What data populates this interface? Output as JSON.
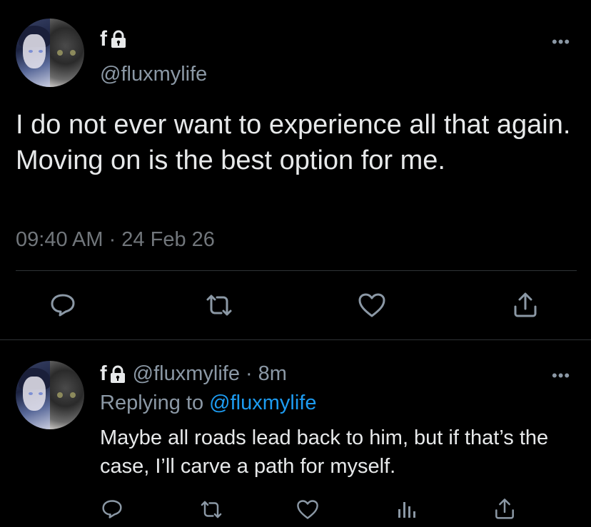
{
  "main_tweet": {
    "display_name": "f",
    "handle": "@fluxmylife",
    "text": "I do not ever want to experience all that again. Moving on is the best option for me.",
    "timestamp": "09:40 AM · 24 Feb 26",
    "more_icon": "more-horizontal-icon",
    "actions": [
      "reply-icon",
      "retweet-icon",
      "like-icon",
      "share-icon"
    ]
  },
  "reply_tweet": {
    "display_name": "f",
    "handle": "@fluxmylife",
    "time_ago": "· 8m",
    "replying_label": "Replying to",
    "replying_handle": "@fluxmylife",
    "text": "Maybe all roads lead back to him, but if that’s the case, I’ll carve a path for myself.",
    "more_icon": "more-horizontal-icon",
    "actions": [
      "reply-icon",
      "retweet-icon",
      "like-icon",
      "analytics-icon",
      "share-icon"
    ]
  },
  "colors": {
    "background": "#000000",
    "text": "#e7e9ea",
    "secondary": "#71767b",
    "link": "#1d9bf0",
    "divider": "#2f3336"
  }
}
